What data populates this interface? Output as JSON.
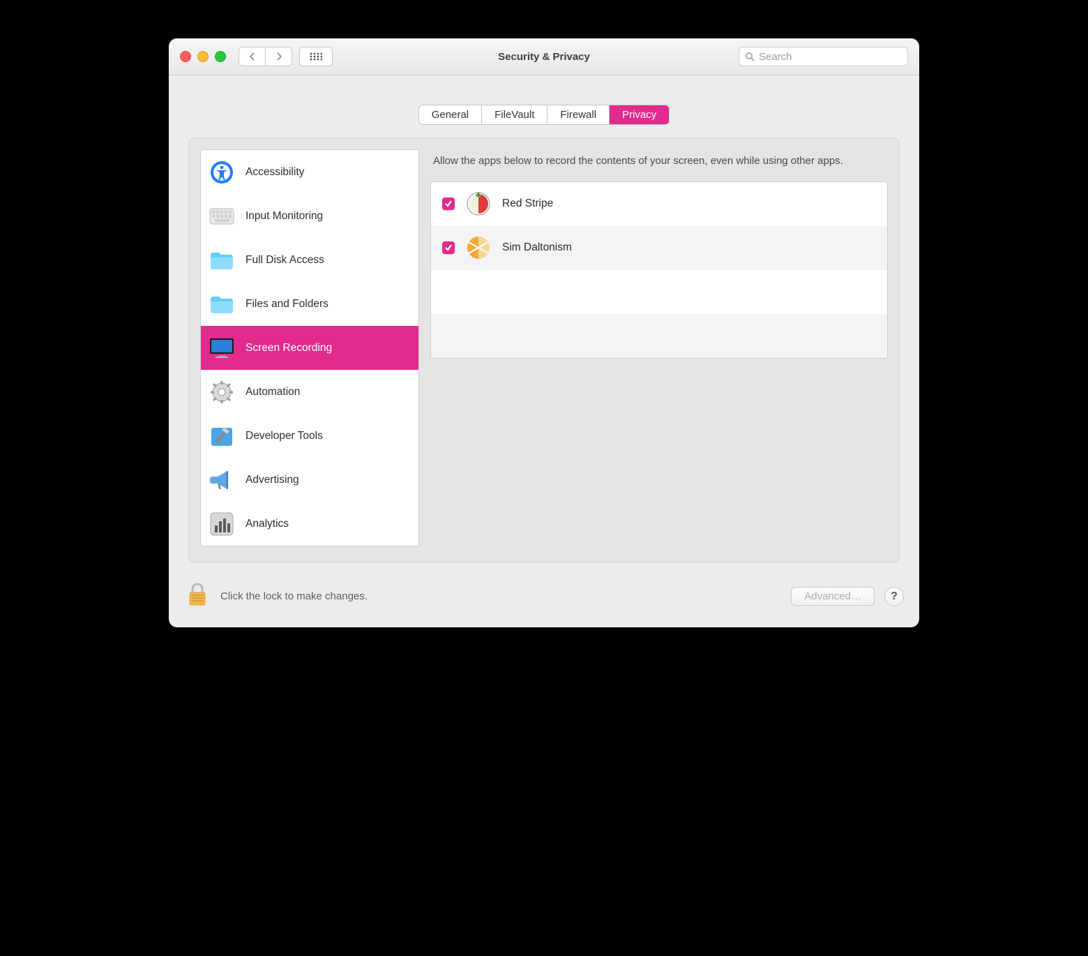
{
  "window": {
    "title": "Security & Privacy"
  },
  "search": {
    "placeholder": "Search"
  },
  "tabs": {
    "general": "General",
    "filevault": "FileVault",
    "firewall": "Firewall",
    "privacy": "Privacy"
  },
  "sidebar": {
    "items": [
      {
        "label": "Accessibility",
        "icon": "accessibility"
      },
      {
        "label": "Input Monitoring",
        "icon": "keyboard"
      },
      {
        "label": "Full Disk Access",
        "icon": "folder"
      },
      {
        "label": "Files and Folders",
        "icon": "folder"
      },
      {
        "label": "Screen Recording",
        "icon": "display",
        "selected": true
      },
      {
        "label": "Automation",
        "icon": "gear"
      },
      {
        "label": "Developer Tools",
        "icon": "hammer"
      },
      {
        "label": "Advertising",
        "icon": "megaphone"
      },
      {
        "label": "Analytics",
        "icon": "barchart"
      }
    ]
  },
  "main": {
    "description": "Allow the apps below to record the contents of your screen, even while using other apps.",
    "apps": [
      {
        "name": "Red Stripe",
        "checked": true
      },
      {
        "name": "Sim Daltonism",
        "checked": true
      }
    ]
  },
  "footer": {
    "lock_text": "Click the lock to make changes.",
    "advanced": "Advanced…",
    "help": "?"
  }
}
